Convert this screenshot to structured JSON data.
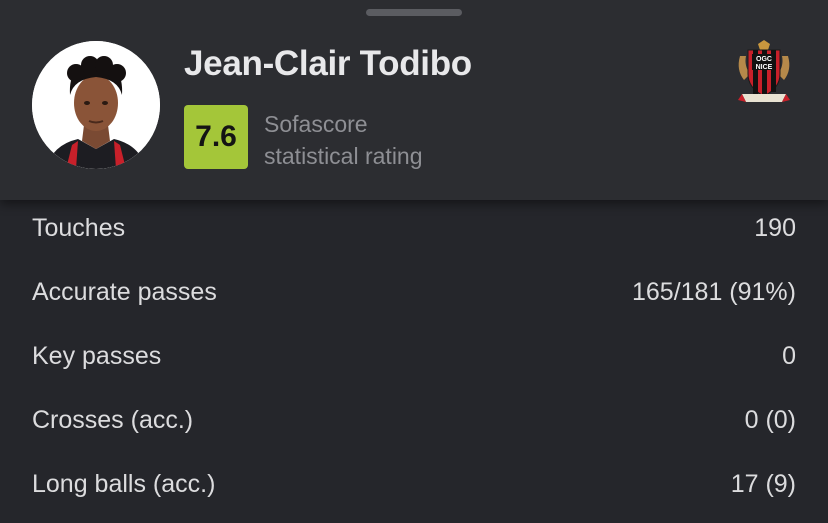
{
  "player": {
    "name": "Jean-Clair Todibo",
    "rating": "7.6",
    "rating_caption_line1": "Sofascore",
    "rating_caption_line2": "statistical rating"
  },
  "club": {
    "logo_text_top": "OGC",
    "logo_text_bottom": "NICE"
  },
  "colors": {
    "rating_badge": "#a4c639",
    "background": "#25262b",
    "header_background": "#2c2d31"
  },
  "stats": [
    {
      "label": "Touches",
      "value": "190"
    },
    {
      "label": "Accurate passes",
      "value": "165/181 (91%)"
    },
    {
      "label": "Key passes",
      "value": "0"
    },
    {
      "label": "Crosses (acc.)",
      "value": "0 (0)"
    },
    {
      "label": "Long balls (acc.)",
      "value": "17 (9)"
    }
  ]
}
